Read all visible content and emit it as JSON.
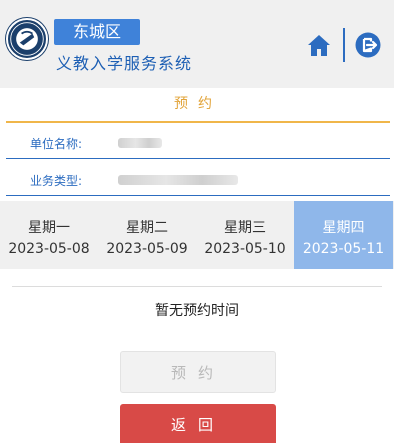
{
  "header": {
    "district": "东城区",
    "system_name": "义教入学服务系统",
    "home_icon": "home-icon",
    "exit_icon": "exit-icon",
    "accent_color": "#3f82d9"
  },
  "section": {
    "title": "预约"
  },
  "form": {
    "unit_name_label": "单位名称:",
    "unit_name_value": "",
    "business_type_label": "业务类型:",
    "business_type_value": ""
  },
  "week": [
    {
      "weekday": "星期一",
      "date": "2023-05-08",
      "active": false
    },
    {
      "weekday": "星期二",
      "date": "2023-05-09",
      "active": false
    },
    {
      "weekday": "星期三",
      "date": "2023-05-10",
      "active": false
    },
    {
      "weekday": "星期四",
      "date": "2023-05-11",
      "active": true
    }
  ],
  "empty_message": "暂无预约时间",
  "buttons": {
    "reserve": "预约",
    "back": "返回"
  }
}
